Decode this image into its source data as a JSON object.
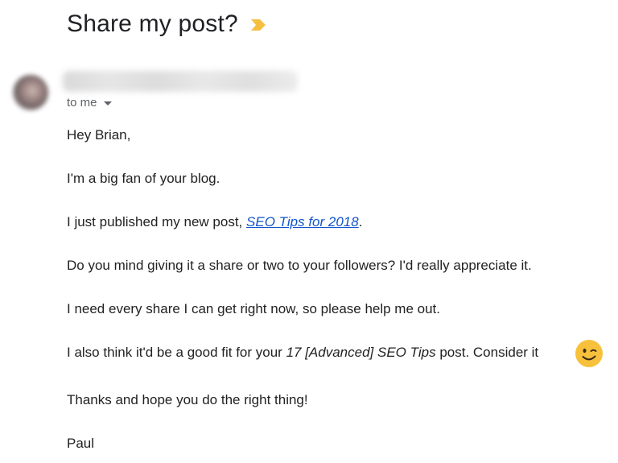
{
  "email": {
    "subject": "Share my post?",
    "recipient_label": "to me",
    "greeting": "Hey Brian,",
    "line1": "I'm a big fan of your blog.",
    "line2_prefix": "I just published my new post, ",
    "line2_link": "SEO Tips for 2018",
    "line2_suffix": ".",
    "line3": "Do you mind giving it a share or two to your followers? I'd really appreciate it.",
    "line4": "I need every share I can get right now, so please help me out.",
    "line5_prefix": "I also think it'd be a good fit for your ",
    "line5_italic": "17 [Advanced] SEO Tips",
    "line5_suffix": " post. Consider it",
    "line6": "Thanks and hope you do the right thing!",
    "signature": "Paul"
  },
  "icons": {
    "importance_marker": "label-importance-icon",
    "recipient_dropdown": "chevron-down-icon",
    "emoji": "winking-face-emoji"
  },
  "colors": {
    "link": "#1155cc",
    "importance_marker": "#f5c042",
    "emoji": "#f7c13c"
  }
}
